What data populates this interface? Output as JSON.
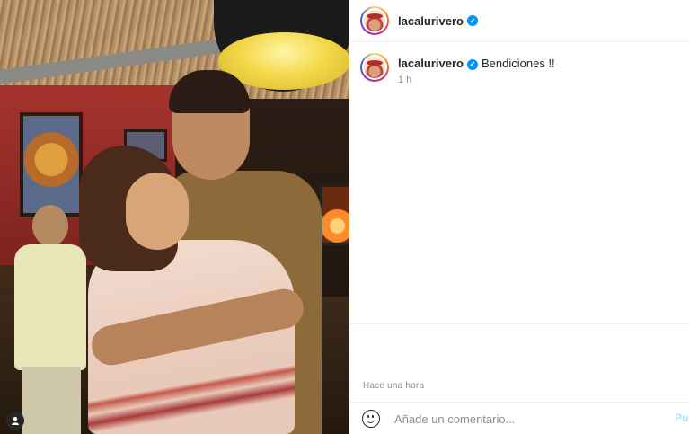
{
  "post": {
    "author": "lacalurivero",
    "verified_glyph": "✓"
  },
  "caption": {
    "author": "lacalurivero",
    "text": "Bendiciones !!",
    "relative_time": "1 h"
  },
  "posted_time": "Hace una hora",
  "compose": {
    "placeholder": "Añade un comentario...",
    "post_label": "Pul"
  },
  "icons": {
    "verified": "verified-badge-icon",
    "emoji": "emoji-smile-icon",
    "tagged_users": "user-tag-icon"
  },
  "colors": {
    "verified_blue": "#0095f6",
    "post_button_disabled": "#b2dffc",
    "muted_text": "#8e8e8e"
  }
}
